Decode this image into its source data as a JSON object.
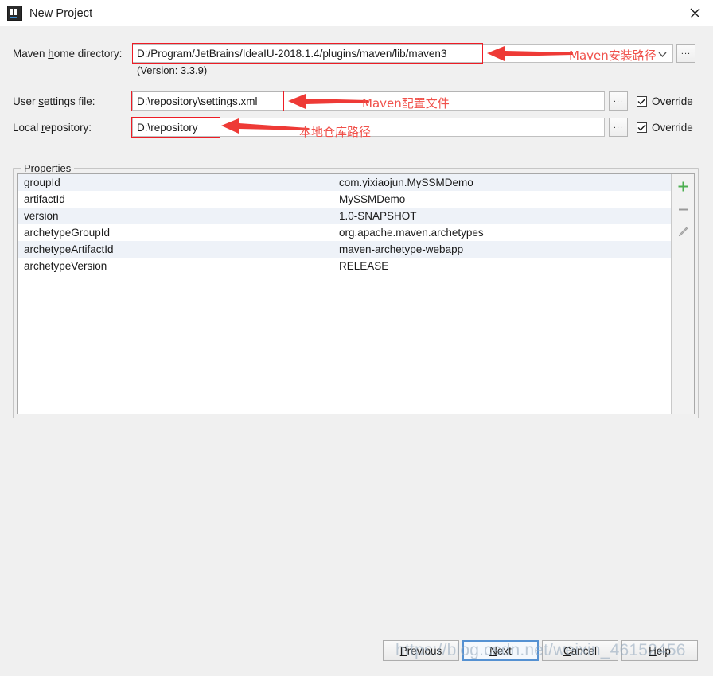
{
  "window": {
    "title": "New Project",
    "app_icon": "intellij-idea-icon",
    "close_icon": "close-icon"
  },
  "form": {
    "maven_home": {
      "label_prefix": "Maven ",
      "label_mnemonic": "h",
      "label_suffix": "ome directory:",
      "value": "D:/Program/JetBrains/IdeaIU-2018.1.4/plugins/maven/lib/maven3",
      "dropdown_icon": "chevron-down-icon",
      "browse_label": "...",
      "version_text": "(Version: 3.3.9)"
    },
    "user_settings": {
      "label_prefix": "User ",
      "label_mnemonic": "s",
      "label_suffix": "ettings file:",
      "value": "D:\\repository\\settings.xml",
      "browse_label": "...",
      "override_label": "Override",
      "override_checked": true
    },
    "local_repository": {
      "label_prefix": "Local ",
      "label_mnemonic": "r",
      "label_suffix": "epository:",
      "value": "D:\\repository",
      "browse_label": "...",
      "override_label": "Override",
      "override_checked": true
    }
  },
  "annotations": [
    {
      "text": "Maven安装路径",
      "target": "maven-home-field"
    },
    {
      "text": "Maven配置文件",
      "target": "user-settings-field"
    },
    {
      "text": "本地仓库路径",
      "target": "local-repository-field"
    }
  ],
  "properties": {
    "group_title": "Properties",
    "rows": [
      {
        "key": "groupId",
        "value": "com.yixiaojun.MySSMDemo"
      },
      {
        "key": "artifactId",
        "value": "MySSMDemo"
      },
      {
        "key": "version",
        "value": "1.0-SNAPSHOT"
      },
      {
        "key": "archetypeGroupId",
        "value": "org.apache.maven.archetypes"
      },
      {
        "key": "archetypeArtifactId",
        "value": "maven-archetype-webapp"
      },
      {
        "key": "archetypeVersion",
        "value": "RELEASE"
      }
    ],
    "toolbar": {
      "add_icon": "plus-icon",
      "remove_icon": "minus-icon",
      "edit_icon": "pencil-icon",
      "add_color": "#4caf50",
      "remove_color": "#9a9a9a",
      "edit_color": "#9a9a9a"
    }
  },
  "buttons": {
    "previous": {
      "prefix": "",
      "mnemonic": "P",
      "suffix": "revious"
    },
    "next": {
      "prefix": "",
      "mnemonic": "N",
      "suffix": "ext"
    },
    "cancel": {
      "prefix": "",
      "mnemonic": "C",
      "suffix": "ancel"
    },
    "help": {
      "prefix": "",
      "mnemonic": "H",
      "suffix": "elp"
    }
  },
  "watermark": {
    "text": "https://blog.csdn.net/weixin_46152456"
  },
  "colors": {
    "annotation_red": "#ee1c25",
    "annotation_text": "#f0504a",
    "focus_blue": "#5591d2",
    "row_alt": "#eef2f8"
  }
}
